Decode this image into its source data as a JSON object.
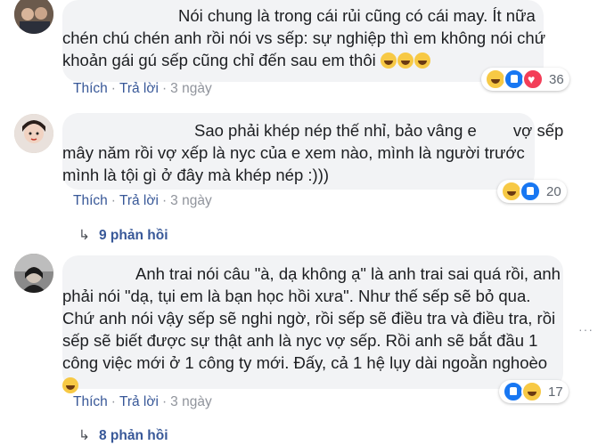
{
  "comments": [
    {
      "lines": [
        "Nói chung là trong cái rủi cũng có cái may. Ít nữa",
        "chén chú chén anh rồi nói vs sếp: sự nghiệp thì em không nói chứ",
        "khoản gái gú sếp cũng chỉ đến sau em thôi"
      ],
      "reaction_count": "36",
      "reaction_icons": [
        "haha-icon",
        "like-icon",
        "love-icon"
      ],
      "action_like": "Thích",
      "action_reply": "Trả lời",
      "time": "3 ngày"
    },
    {
      "lines": [
        "Sao phải khép nép thế nhỉ, bảo vâng e        vợ sếp",
        "mây năm rồi vợ xếp là nyc của e xem nào, mình là người trước",
        "mình là tội gì ở đây mà khép nép :)))"
      ],
      "reaction_count": "20",
      "reaction_icons": [
        "haha-icon",
        "like-icon"
      ],
      "action_like": "Thích",
      "action_reply": "Trả lời",
      "time": "3 ngày",
      "replies_label": "9 phản hồi"
    },
    {
      "lines": [
        "Anh trai nói câu \"à, dạ không ạ\" là anh trai sai quá rồi, anh",
        "phải nói \"dạ, tụi em là bạn học hồi xưa\". Như thế sếp sẽ bỏ qua.",
        "Chứ anh nói vậy sếp sẽ nghi ngờ, rồi sếp sẽ điều tra và điều tra, rồi",
        "sếp sẽ biết được sự thật anh là nyc vợ sếp. Rồi anh sẽ bắt đầu 1",
        "công việc mới ở 1 công ty mới. Đấy, cả 1 hệ lụy dài ngoằn nghoèo"
      ],
      "reaction_count": "17",
      "reaction_icons": [
        "like-icon",
        "haha-icon"
      ],
      "action_like": "Thích",
      "action_reply": "Trả lời",
      "time": "3 ngày",
      "replies_label": "8 phản hồi"
    }
  ],
  "colors": {
    "bubble": "#f2f3f5",
    "link": "#385898",
    "meta": "#90949c",
    "like": "#1877f2",
    "haha": "#f7c945",
    "love": "#f33e58"
  }
}
